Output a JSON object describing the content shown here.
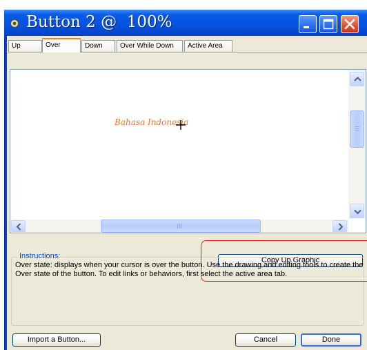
{
  "window": {
    "title": "Button 2 @  100%",
    "controls": {
      "minimize_icon": "minimize-icon",
      "maximize_icon": "maximize-icon",
      "close_icon": "close-icon"
    }
  },
  "tabs": [
    {
      "label": "Up",
      "active": false
    },
    {
      "label": "Over",
      "active": true
    },
    {
      "label": "Down",
      "active": false
    },
    {
      "label": "Over While Down",
      "active": false
    },
    {
      "label": "Active Area",
      "active": false
    }
  ],
  "canvas": {
    "text": "Bahasa Indonesia",
    "text_color": "#e8762c",
    "cursor_icon": "crosshair-cursor-icon"
  },
  "buttons": {
    "copy_up_graphic": "Copy Up Graphic",
    "import": "Import a Button...",
    "cancel": "Cancel",
    "done": "Done"
  },
  "instructions": {
    "label": "Instructions:",
    "text": "Over state: displays when your cursor is over the button. Use the drawing and editing tools to create the Over state of the button. To edit links or behaviors, first select the active area tab."
  },
  "colors": {
    "titlebar": "#0553e0",
    "dialog_bg": "#ece9d8",
    "annotation": "#e02020",
    "group_label": "#0046d5"
  }
}
